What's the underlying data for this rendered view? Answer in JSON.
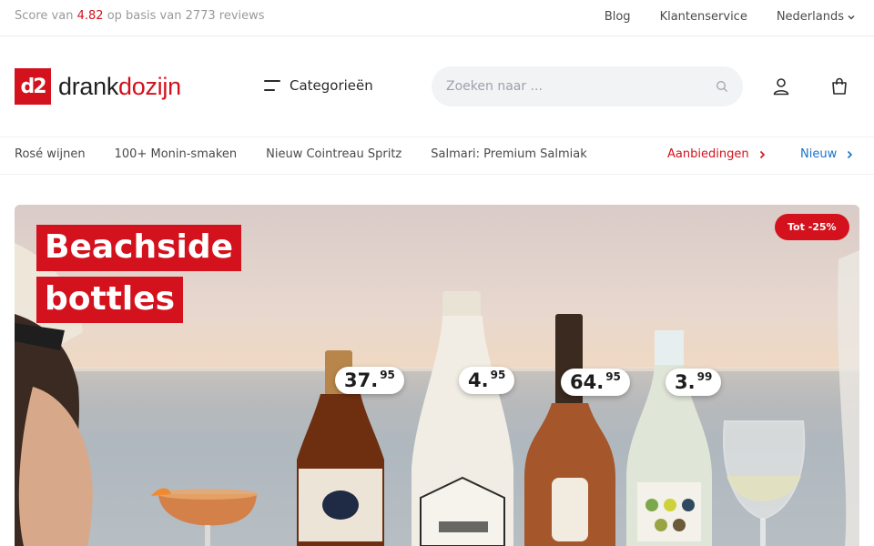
{
  "topbar": {
    "score_prefix": "Score van",
    "rating": "4.82",
    "score_suffix": "op basis van 2773 reviews",
    "links": {
      "blog": "Blog",
      "service": "Klantenservice",
      "language": "Nederlands"
    }
  },
  "header": {
    "logo_mark": "d2",
    "logo_text_main": "drank",
    "logo_text_accent": "dozijn",
    "categories_label": "Categorieën",
    "search_placeholder": "Zoeken naar ..."
  },
  "nav": {
    "items": [
      "Rosé wijnen",
      "100+ Monin-smaken",
      "Nieuw Cointreau Spritz",
      "Salmari: Premium Salmiak"
    ],
    "deals": "Aanbiedingen",
    "new": "Nieuw"
  },
  "hero": {
    "title_line1": "Beachside",
    "title_line2": "bottles",
    "badge": "Tot -25%",
    "prices": [
      {
        "int": "37.",
        "dec": "95"
      },
      {
        "int": "4.",
        "dec": "95"
      },
      {
        "int": "64.",
        "dec": "95"
      },
      {
        "int": "3.",
        "dec": "99"
      }
    ]
  },
  "colors": {
    "brand_red": "#d3121d",
    "link_blue": "#1a73c9"
  },
  "icons": [
    "search-icon",
    "account-icon",
    "cart-icon",
    "menu-icon",
    "chevron-down-icon",
    "chevron-right-icon"
  ]
}
